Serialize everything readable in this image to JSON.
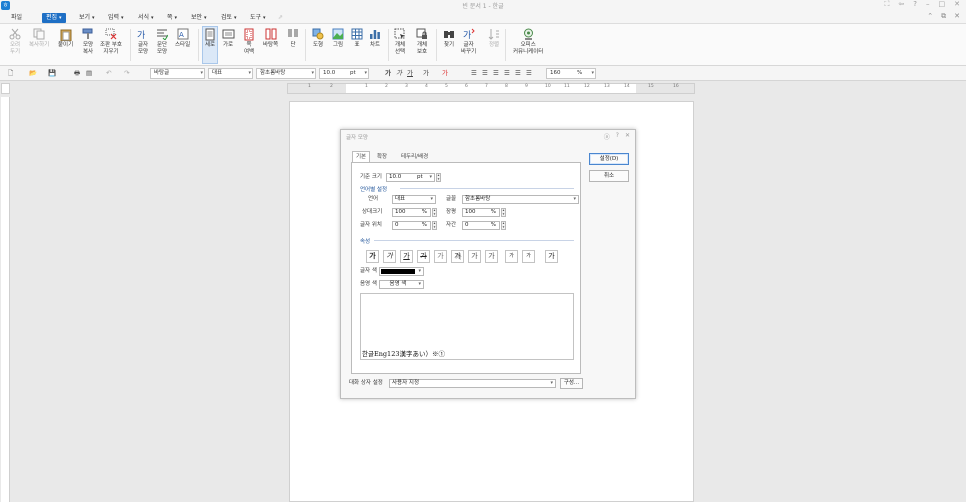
{
  "window": {
    "title": "빈 문서 1 - 한글",
    "controls": [
      "⛶",
      "⇦",
      "?",
      "–",
      "□",
      "✕"
    ]
  },
  "menu": {
    "file": "파일",
    "items": [
      "편집",
      "보기",
      "입력",
      "서식",
      "쪽",
      "보안",
      "검토",
      "도구"
    ]
  },
  "ribbon": {
    "buttons": [
      {
        "label": "오려\n두기"
      },
      {
        "label": "복사하기"
      },
      {
        "label": "붙이기"
      },
      {
        "label": "모양\n복사"
      },
      {
        "label": "조판 부호\n지우기"
      },
      {
        "label": "글자\n모양"
      },
      {
        "label": "문단\n모양"
      },
      {
        "label": "스타일"
      },
      {
        "label": "세로"
      },
      {
        "label": "가로"
      },
      {
        "label": "쪽\n여백"
      },
      {
        "label": "바탕쪽"
      },
      {
        "label": "단"
      },
      {
        "label": "도형"
      },
      {
        "label": "그림"
      },
      {
        "label": "표"
      },
      {
        "label": "차트"
      },
      {
        "label": "개체\n선택"
      },
      {
        "label": "개체\n보호"
      },
      {
        "label": "찾기"
      },
      {
        "label": "글자\n바꾸기"
      },
      {
        "label": "정렬"
      },
      {
        "label": "오피스\n커뮤니케이터"
      }
    ]
  },
  "toolbar": {
    "style_combo": "바탕글",
    "lang_combo": "대표",
    "font_combo": "함초롬바탕",
    "size_value": "10.0",
    "size_unit": "pt",
    "zoom_value": "160",
    "zoom_unit": "%",
    "glyphs": [
      "가",
      "가",
      "가",
      "가",
      "가"
    ]
  },
  "ruler": {
    "numbers": [
      "1",
      "2",
      "1",
      "2",
      "3",
      "4",
      "5",
      "6",
      "7",
      "8",
      "9",
      "10",
      "11",
      "12",
      "13",
      "14",
      "15",
      "16"
    ]
  },
  "dialog": {
    "title": "글자 모양",
    "title_buttons": [
      "ⓐ",
      "?",
      "✕"
    ],
    "tabs": [
      "기본",
      "확장",
      "테두리/배경"
    ],
    "base_size_label": "기준 크기",
    "base_size_value": "10.0",
    "base_size_unit": "pt",
    "section_lang": "언어별 설정",
    "lang_label": "언어",
    "lang_value": "대표",
    "font_label": "글꼴",
    "font_value": "함초롬바탕",
    "rel_size_label": "상대크기",
    "rel_size_value": "100",
    "rel_size_unit": "%",
    "width_label": "장평",
    "width_value": "100",
    "width_unit": "%",
    "pos_label": "글자 위치",
    "pos_value": "0",
    "pos_unit": "%",
    "spacing_label": "자간",
    "spacing_value": "0",
    "spacing_unit": "%",
    "section_attr": "속성",
    "attr_buttons": [
      "가",
      "가",
      "가",
      "가",
      "가",
      "가",
      "가",
      "가",
      "가",
      "가",
      "가"
    ],
    "text_color_label": "글자 색",
    "shade_color_label": "음영 색",
    "shade_color_value": "음영 색",
    "text_color": "#000000",
    "preview_text": "한글Eng123漢字あい）※①",
    "ok_button": "설정(D)",
    "cancel_button": "취소",
    "preset_label": "대화 상자 설정",
    "preset_value": "사용자 지정",
    "config_button": "구성..."
  }
}
